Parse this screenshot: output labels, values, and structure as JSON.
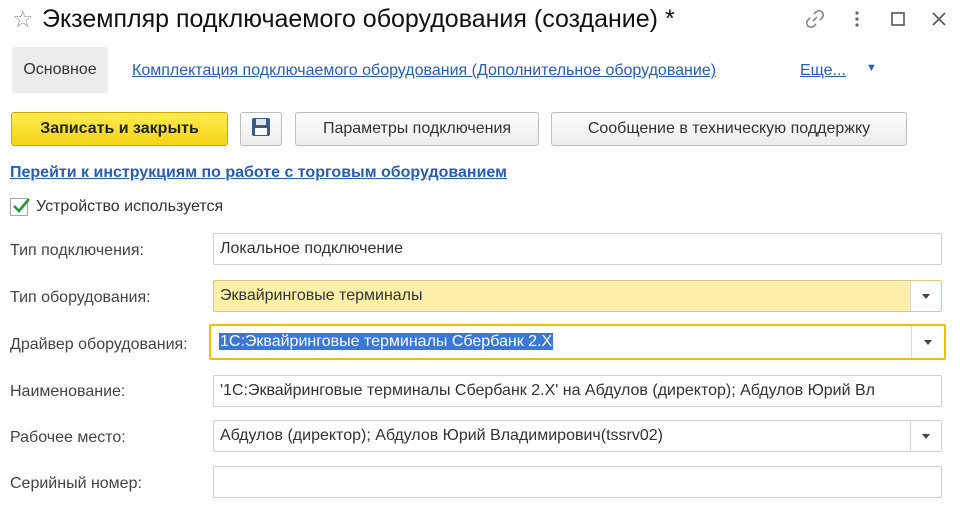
{
  "window": {
    "title": "Экземпляр подключаемого оборудования (создание) *",
    "icons": [
      "star-icon",
      "link-icon",
      "more-vertical-icon",
      "maximize-icon",
      "close-icon"
    ]
  },
  "nav": {
    "active": "Основное",
    "link": "Комплектация подключаемого оборудования (Дополнительное оборудование)",
    "more": "Еще..."
  },
  "toolbar": {
    "save_close": "Записать и закрыть",
    "params": "Параметры подключения",
    "support": "Сообщение в техническую поддержку"
  },
  "help_link": "Перейти к инструкциям по работе с торговым оборудованием",
  "device_used": {
    "label": "Устройство используется",
    "checked": true
  },
  "form": {
    "connection_type": {
      "label": "Тип подключения:",
      "value": "Локальное подключение"
    },
    "equipment_type": {
      "label": "Тип оборудования:",
      "value": "Эквайринговые терминалы"
    },
    "driver": {
      "label": "Драйвер оборудования:",
      "value": "1С:Эквайринговые терминалы Сбербанк 2.X"
    },
    "name": {
      "label": "Наименование:",
      "value": "'1С:Эквайринговые терминалы Сбербанк 2.X' на Абдулов (директор); Абдулов Юрий Вл"
    },
    "workplace": {
      "label": "Рабочее место:",
      "value": "Абдулов (директор); Абдулов Юрий Владимирович(tssrv02)"
    },
    "serial": {
      "label": "Серийный номер:",
      "value": ""
    }
  },
  "colors": {
    "accent_yellow": "#f5d418",
    "link_blue": "#2a5db0",
    "selection": "#3a78d8"
  }
}
